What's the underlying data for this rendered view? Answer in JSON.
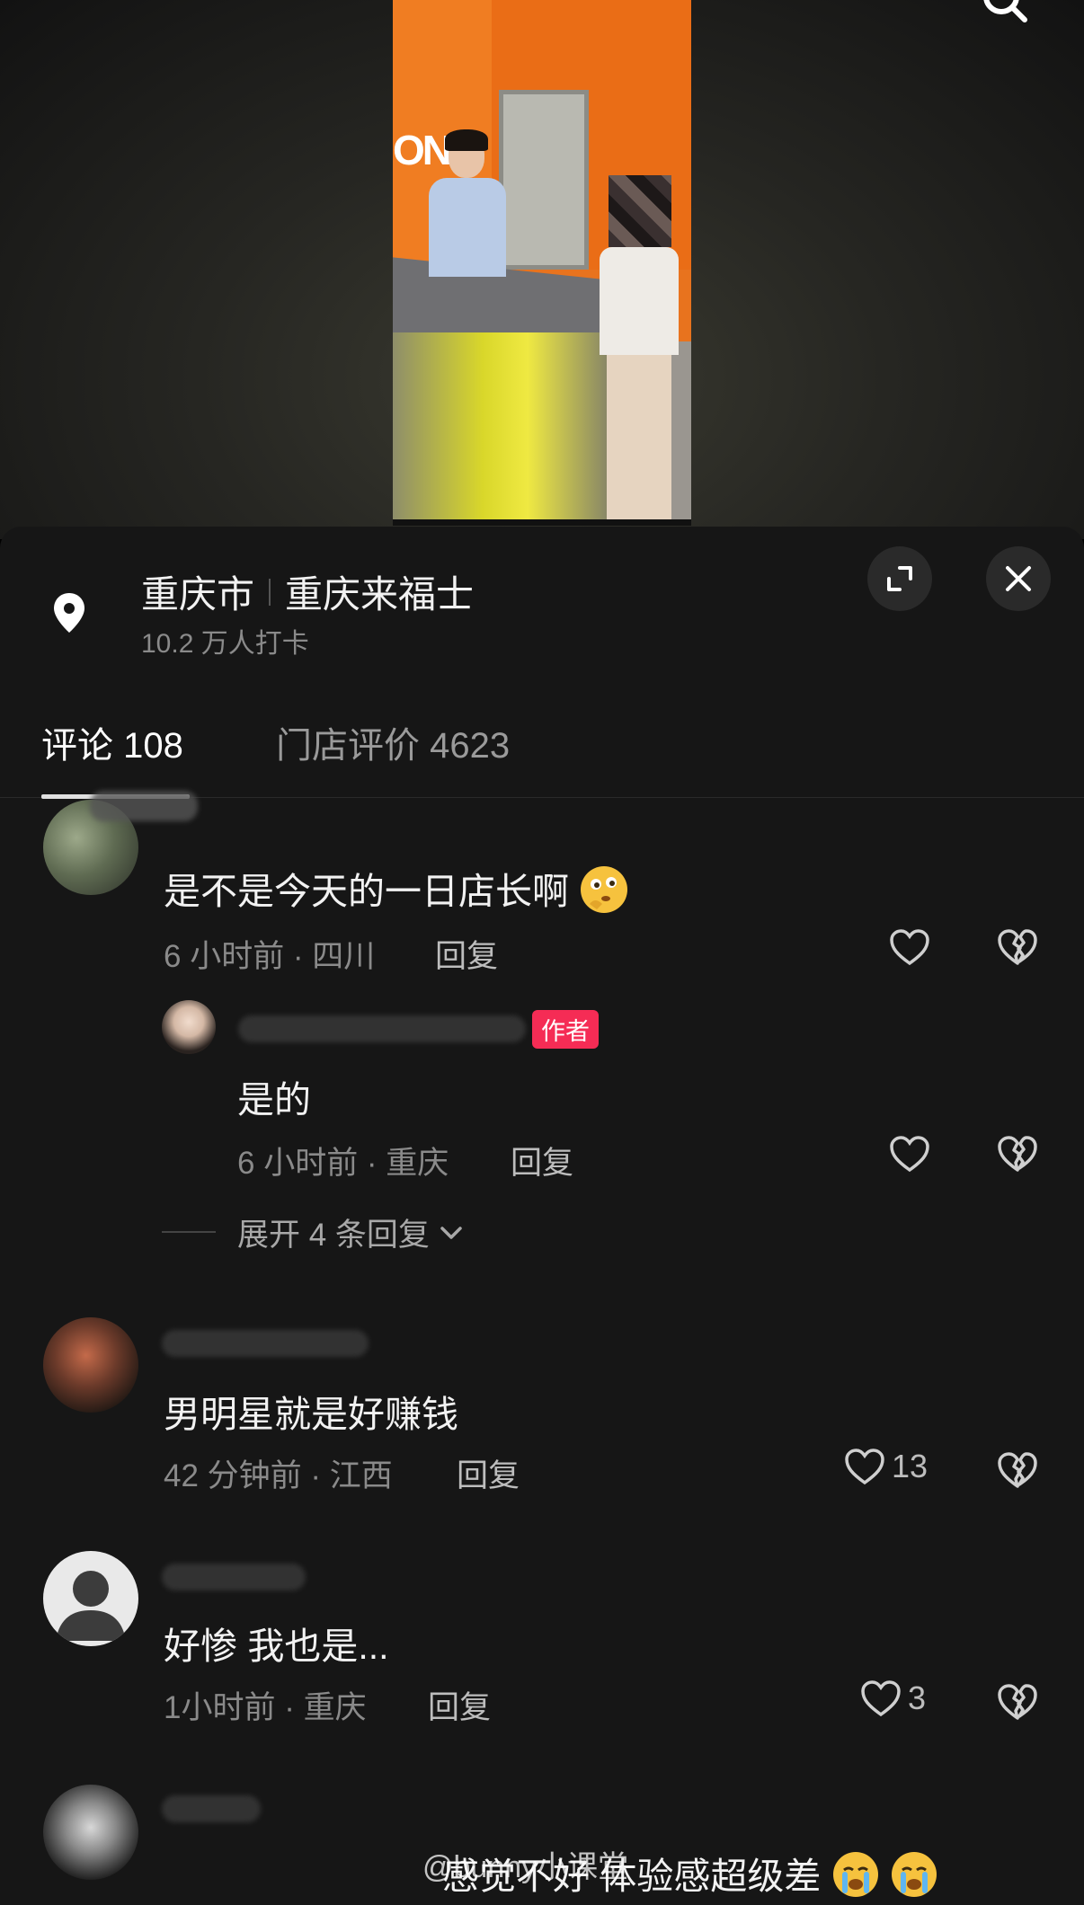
{
  "location": {
    "city": "重庆市",
    "place": "重庆来福士",
    "checkins": "10.2 万人打卡"
  },
  "tabs": [
    {
      "label": "评论 108"
    },
    {
      "label": "门店评价 4623"
    }
  ],
  "comments": [
    {
      "text": "是不是今天的一日店长啊",
      "meta": "6 小时前 · 四川",
      "reply_label": "回复",
      "likes": ""
    },
    {
      "text": "男明星就是好赚钱",
      "meta": "42 分钟前 · 江西",
      "reply_label": "回复",
      "likes": "13"
    },
    {
      "text": "好惨 我也是...",
      "meta": "1小时前 · 重庆",
      "reply_label": "回复",
      "likes": "3"
    },
    {
      "text": "感觉不好 体验感超级差"
    }
  ],
  "author_reply": {
    "badge": "作者",
    "text": "是的",
    "meta": "6 小时前 · 重庆",
    "reply_label": "回复"
  },
  "expand_replies": "展开 4 条回复",
  "watermark": "@bunny小课堂",
  "video_sign": "ON",
  "colors": {
    "sheet_bg": "#161616",
    "author_badge": "#f52c55",
    "muted_text": "#8a8a8a"
  }
}
